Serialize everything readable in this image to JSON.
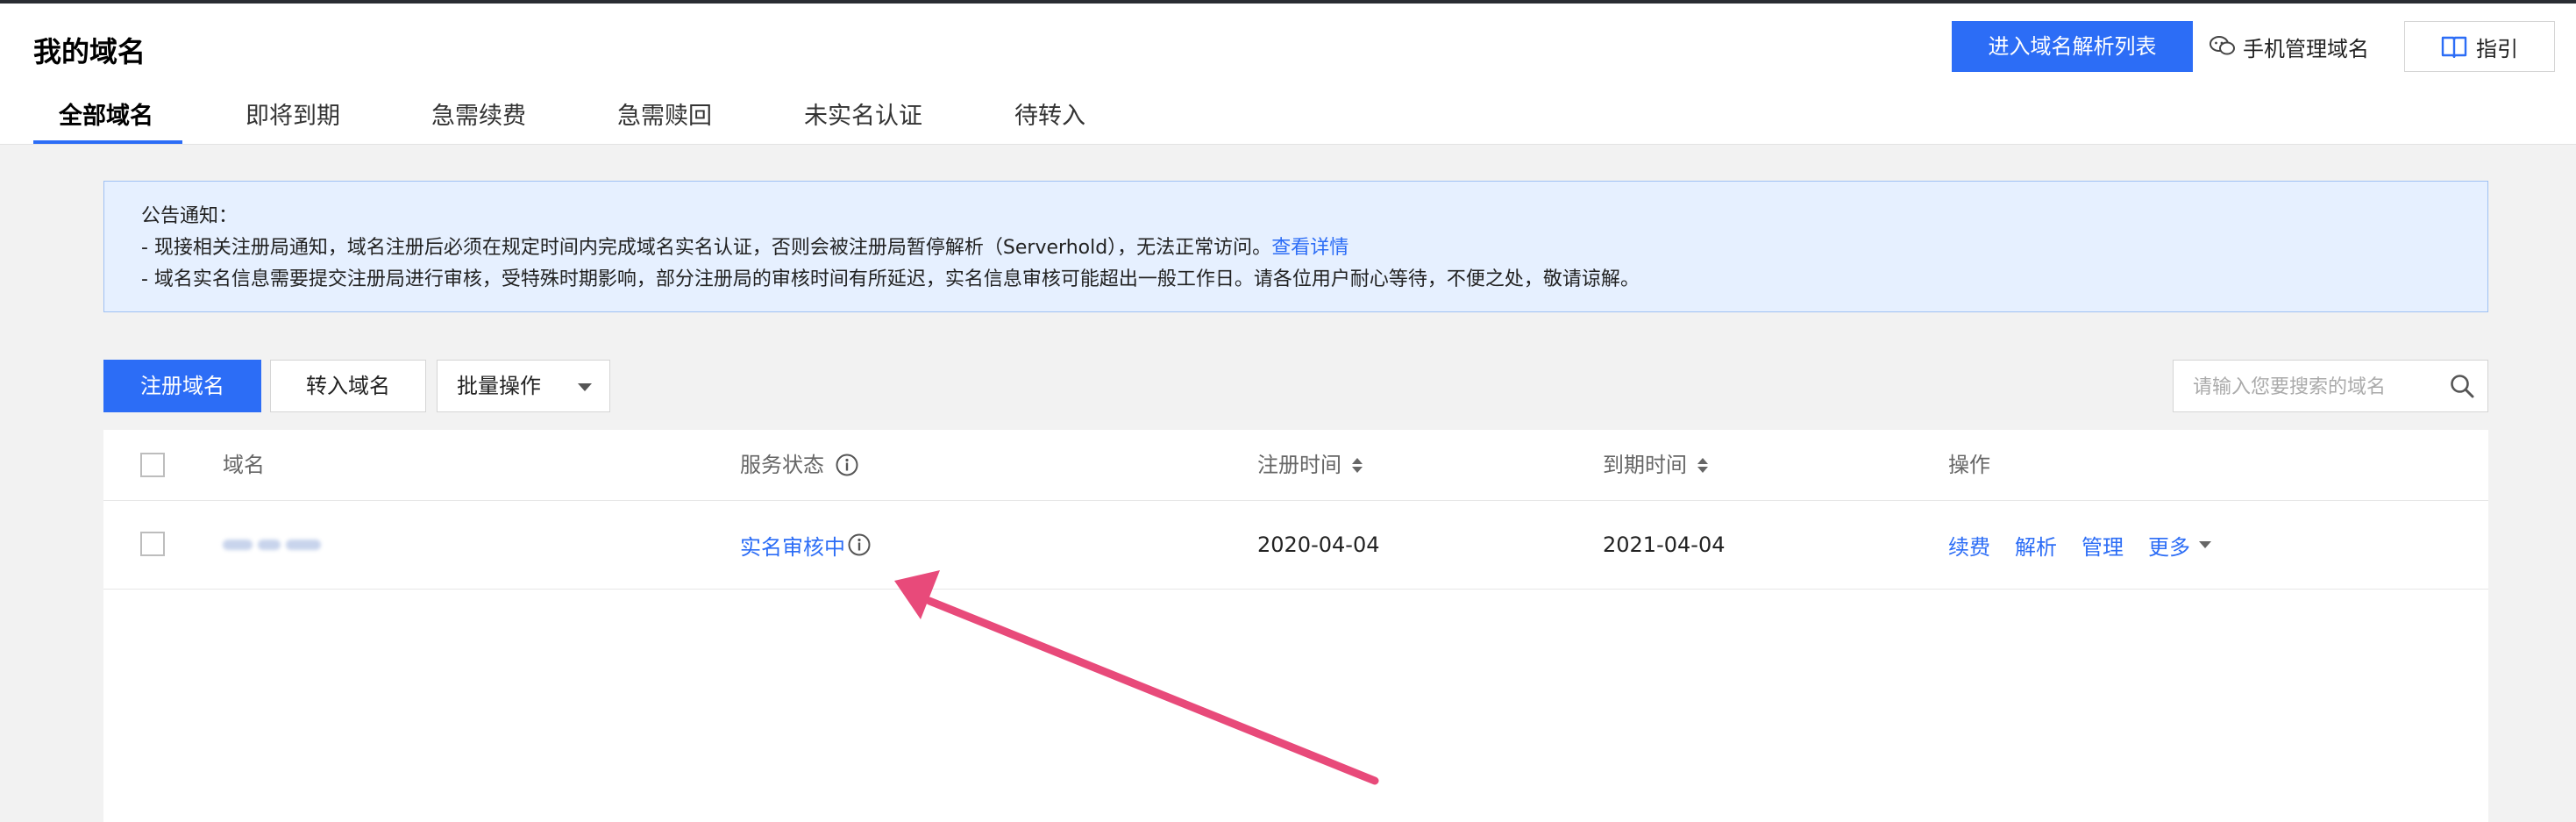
{
  "header": {
    "title": "我的域名",
    "dns_list_button": "进入域名解析列表",
    "mobile_manage": "手机管理域名",
    "guide": "指引"
  },
  "tabs": [
    {
      "label": "全部域名",
      "active": true
    },
    {
      "label": "即将到期"
    },
    {
      "label": "急需续费"
    },
    {
      "label": "急需赎回"
    },
    {
      "label": "未实名认证"
    },
    {
      "label": "待转入"
    }
  ],
  "notice": {
    "heading": "公告通知：",
    "line1": "- 现接相关注册局通知，域名注册后必须在规定时间内完成域名实名认证，否则会被注册局暂停解析（Serverhold），无法正常访问。",
    "line1_link": "查看详情",
    "line2": "- 域名实名信息需要提交注册局进行审核，受特殊时期影响，部分注册局的审核时间有所延迟，实名信息审核可能超出一般工作日。请各位用户耐心等待，不便之处，敬请谅解。"
  },
  "toolbar": {
    "register": "注册域名",
    "transfer": "转入域名",
    "batch": "批量操作",
    "search_placeholder": "请输入您要搜索的域名"
  },
  "table": {
    "columns": {
      "domain": "域名",
      "status": "服务状态",
      "register_time": "注册时间",
      "expire_time": "到期时间",
      "actions": "操作"
    },
    "rows": [
      {
        "status": "实名审核中",
        "register_time": "2020-04-04",
        "expire_time": "2021-04-04",
        "actions": {
          "renew": "续费",
          "resolve": "解析",
          "manage": "管理",
          "more": "更多"
        }
      }
    ]
  },
  "colors": {
    "accent": "#2c6df6",
    "annotation_arrow": "#e84a7a",
    "notice_bg": "#e6f0ff"
  }
}
